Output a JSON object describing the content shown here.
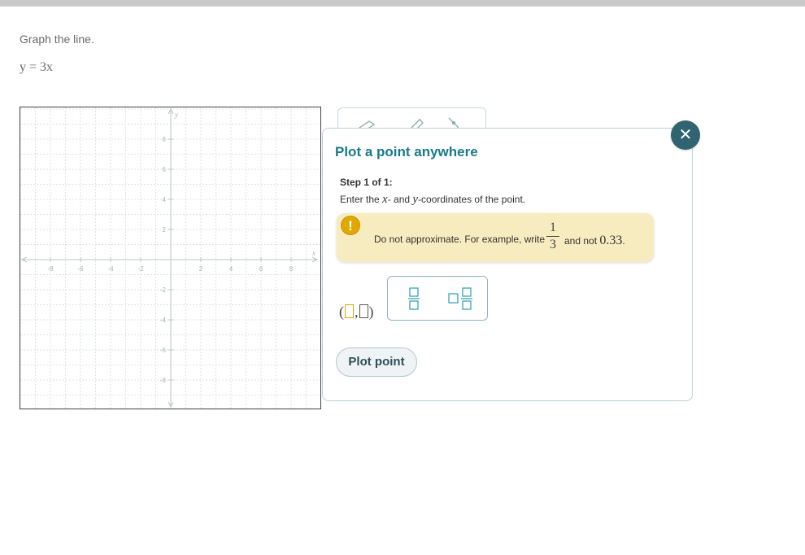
{
  "question": {
    "instruction": "Graph the line.",
    "equation": "y = 3x"
  },
  "graph": {
    "x_axis_label": "x",
    "y_axis_label": "y",
    "x_ticks": [
      "-8",
      "-6",
      "-4",
      "-2",
      "2",
      "4",
      "6",
      "8"
    ],
    "y_ticks": [
      "8",
      "6",
      "4",
      "2",
      "-2",
      "-4",
      "-6",
      "-8"
    ]
  },
  "toolbar": {
    "tools": [
      "eraser-icon",
      "pencil-icon",
      "point-tool-icon"
    ]
  },
  "popup": {
    "title": "Plot a point anywhere",
    "step_label": "Step 1 of 1:",
    "step_text_prefix": "Enter the ",
    "x_var": "x",
    "step_text_mid": "- and ",
    "y_var": "y",
    "step_text_suffix": "-coordinates of the point.",
    "warning": {
      "text_before": "Do not approximate. For example, write",
      "fraction_numerator": "1",
      "fraction_denominator": "3",
      "text_after": "and not",
      "decimal": "0.33",
      "period": "."
    },
    "keypad": {
      "keys": [
        "fraction-key",
        "mixed-number-key"
      ]
    },
    "plot_button_label": "Plot point"
  },
  "colors": {
    "accent": "#187a8a",
    "close_button": "#2f6470",
    "warning_bg": "#f7ecbf",
    "warning_icon": "#e0a800"
  }
}
